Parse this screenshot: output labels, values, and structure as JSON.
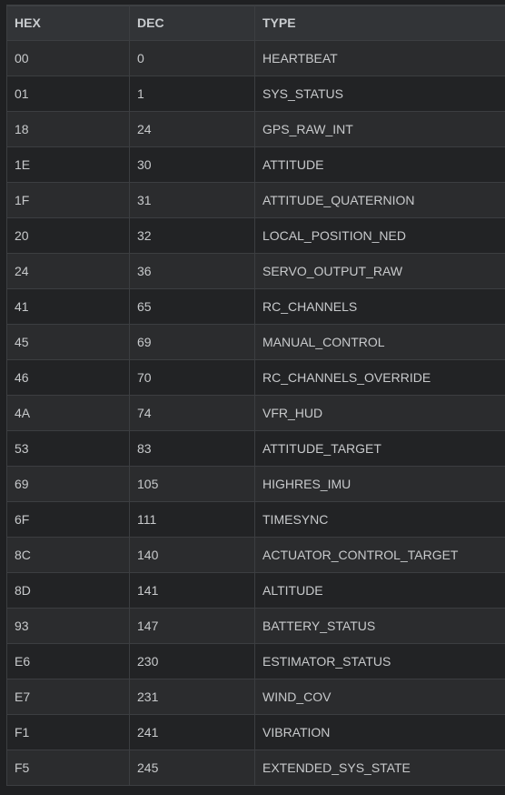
{
  "table": {
    "headers": {
      "hex": "HEX",
      "dec": "DEC",
      "type": "TYPE"
    },
    "rows": [
      {
        "hex": "00",
        "dec": "0",
        "type": "HEARTBEAT"
      },
      {
        "hex": "01",
        "dec": "1",
        "type": "SYS_STATUS"
      },
      {
        "hex": "18",
        "dec": "24",
        "type": "GPS_RAW_INT"
      },
      {
        "hex": "1E",
        "dec": "30",
        "type": "ATTITUDE"
      },
      {
        "hex": "1F",
        "dec": "31",
        "type": "ATTITUDE_QUATERNION"
      },
      {
        "hex": "20",
        "dec": "32",
        "type": "LOCAL_POSITION_NED"
      },
      {
        "hex": "24",
        "dec": "36",
        "type": "SERVO_OUTPUT_RAW"
      },
      {
        "hex": "41",
        "dec": "65",
        "type": "RC_CHANNELS"
      },
      {
        "hex": "45",
        "dec": "69",
        "type": "MANUAL_CONTROL"
      },
      {
        "hex": "46",
        "dec": "70",
        "type": "RC_CHANNELS_OVERRIDE"
      },
      {
        "hex": "4A",
        "dec": "74",
        "type": "VFR_HUD"
      },
      {
        "hex": "53",
        "dec": "83",
        "type": "ATTITUDE_TARGET"
      },
      {
        "hex": "69",
        "dec": "105",
        "type": "HIGHRES_IMU"
      },
      {
        "hex": "6F",
        "dec": "111",
        "type": "TIMESYNC"
      },
      {
        "hex": "8C",
        "dec": "140",
        "type": "ACTUATOR_CONTROL_TARGET"
      },
      {
        "hex": "8D",
        "dec": "141",
        "type": "ALTITUDE"
      },
      {
        "hex": "93",
        "dec": "147",
        "type": "BATTERY_STATUS"
      },
      {
        "hex": "E6",
        "dec": "230",
        "type": "ESTIMATOR_STATUS"
      },
      {
        "hex": "E7",
        "dec": "231",
        "type": "WIND_COV"
      },
      {
        "hex": "F1",
        "dec": "241",
        "type": "VIBRATION"
      },
      {
        "hex": "F5",
        "dec": "245",
        "type": "EXTENDED_SYS_STATE"
      }
    ]
  }
}
